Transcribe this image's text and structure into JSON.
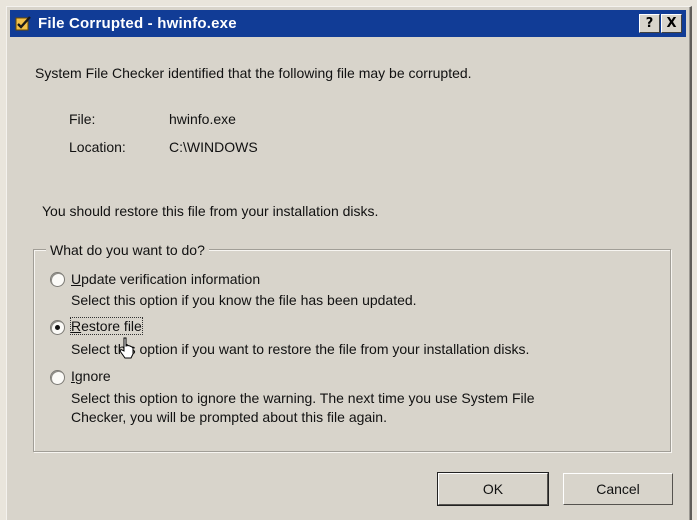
{
  "window": {
    "title": "File Corrupted - hwinfo.exe",
    "help_button": "?",
    "close_button": "X"
  },
  "message": "System File Checker identified that the following file may be corrupted.",
  "details": {
    "file_label": "File:",
    "file_value": "hwinfo.exe",
    "location_label": "Location:",
    "location_value": "C:\\WINDOWS"
  },
  "advice": "You should restore this file from your installation disks.",
  "group": {
    "legend": "What do you want to do?",
    "options": [
      {
        "label": "Update verification information",
        "description": "Select this option if you know the file has been updated.",
        "selected": false
      },
      {
        "label": "Restore file",
        "description": "Select this option if you want to restore the file from your installation disks.",
        "selected": true
      },
      {
        "label": "Ignore",
        "description_line1": "Select this option to ignore the warning. The next time you use System File",
        "description_line2": "Checker, you will be prompted about this file again.",
        "selected": false
      }
    ]
  },
  "buttons": {
    "ok": "OK",
    "cancel": "Cancel"
  },
  "colors": {
    "titlebar": "#113c96",
    "dialog_face": "#d8d4cb"
  }
}
